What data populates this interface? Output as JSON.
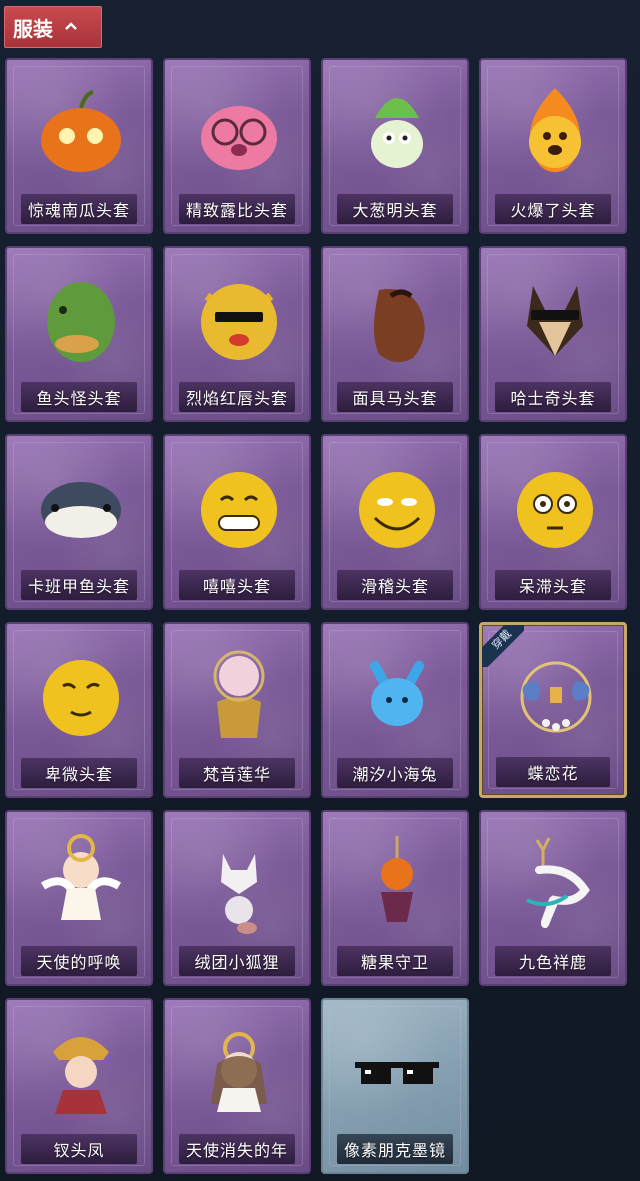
{
  "header": {
    "title": "服装"
  },
  "items": [
    {
      "label": "惊魂南瓜头套",
      "icon": "pumpkin-head-icon"
    },
    {
      "label": "精致露比头套",
      "icon": "pink-creature-head-icon"
    },
    {
      "label": "大葱明头套",
      "icon": "scallion-head-icon"
    },
    {
      "label": "火爆了头套",
      "icon": "fire-head-icon"
    },
    {
      "label": "鱼头怪头套",
      "icon": "fish-head-icon"
    },
    {
      "label": "烈焰红唇头套",
      "icon": "yellow-mascot-head-icon"
    },
    {
      "label": "面具马头套",
      "icon": "horse-head-icon"
    },
    {
      "label": "哈士奇头套",
      "icon": "husky-head-icon"
    },
    {
      "label": "卡班甲鱼头套",
      "icon": "turtle-head-icon"
    },
    {
      "label": "嘻嘻头套",
      "icon": "grin-emoji-icon"
    },
    {
      "label": "滑稽头套",
      "icon": "funny-emoji-icon"
    },
    {
      "label": "呆滞头套",
      "icon": "dazed-emoji-icon"
    },
    {
      "label": "卑微头套",
      "icon": "humble-emoji-icon"
    },
    {
      "label": "梵音莲华",
      "icon": "lotus-doll-icon"
    },
    {
      "label": "潮汐小海兔",
      "icon": "sea-bunny-icon"
    },
    {
      "label": "蝶恋花",
      "icon": "butterfly-flower-icon",
      "badge": "穿戴",
      "equipped": true
    },
    {
      "label": "天使的呼唤",
      "icon": "angel-doll-icon"
    },
    {
      "label": "绒团小狐狸",
      "icon": "fox-charm-icon"
    },
    {
      "label": "糖果守卫",
      "icon": "candy-guard-icon"
    },
    {
      "label": "九色祥鹿",
      "icon": "deer-charm-icon"
    },
    {
      "label": "钗头凤",
      "icon": "phoenix-doll-icon"
    },
    {
      "label": "天使消失的年",
      "icon": "angel-girl-doll-icon"
    },
    {
      "label": "像素朋克墨镜",
      "icon": "pixel-sunglasses-icon",
      "grey": true
    }
  ]
}
